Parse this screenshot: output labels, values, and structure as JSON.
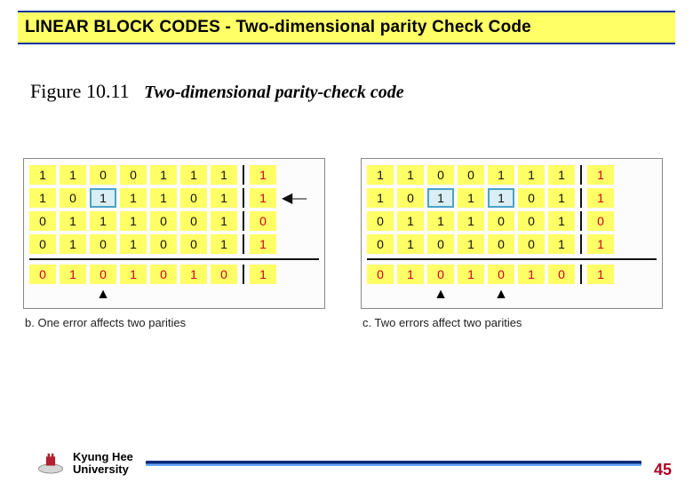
{
  "title": "LINEAR BLOCK CODES - Two-dimensional parity Check Code",
  "figure": {
    "number": "Figure 10.11",
    "caption": "Two-dimensional parity-check code"
  },
  "chart_data": [
    {
      "type": "table",
      "label": "b",
      "caption": "One error affects two parities",
      "data_rows": [
        [
          1,
          1,
          0,
          0,
          1,
          1,
          1
        ],
        [
          1,
          0,
          1,
          1,
          1,
          0,
          1
        ],
        [
          0,
          1,
          1,
          1,
          0,
          0,
          1
        ],
        [
          0,
          1,
          0,
          1,
          0,
          0,
          1
        ]
      ],
      "row_parity": [
        1,
        1,
        0,
        1
      ],
      "col_parity_row": [
        0,
        1,
        0,
        1,
        0,
        1,
        0
      ],
      "overall_parity": 1,
      "boxed_cells": [
        [
          1,
          2
        ]
      ],
      "row_arrow_indices": [
        1
      ],
      "col_arrow_indices": [
        2
      ]
    },
    {
      "type": "table",
      "label": "c",
      "caption": "Two errors affect two parities",
      "data_rows": [
        [
          1,
          1,
          0,
          0,
          1,
          1,
          1
        ],
        [
          1,
          0,
          1,
          1,
          1,
          0,
          1
        ],
        [
          0,
          1,
          1,
          1,
          0,
          0,
          1
        ],
        [
          0,
          1,
          0,
          1,
          0,
          0,
          1
        ]
      ],
      "row_parity": [
        1,
        1,
        0,
        1
      ],
      "col_parity_row": [
        0,
        1,
        0,
        1,
        0,
        1,
        0
      ],
      "overall_parity": 1,
      "boxed_cells": [
        [
          1,
          2
        ],
        [
          1,
          4
        ]
      ],
      "row_arrow_indices": [],
      "col_arrow_indices": [
        2,
        4
      ]
    }
  ],
  "footer": {
    "uni1": "Kyung Hee",
    "uni2": "University",
    "page": "45"
  }
}
